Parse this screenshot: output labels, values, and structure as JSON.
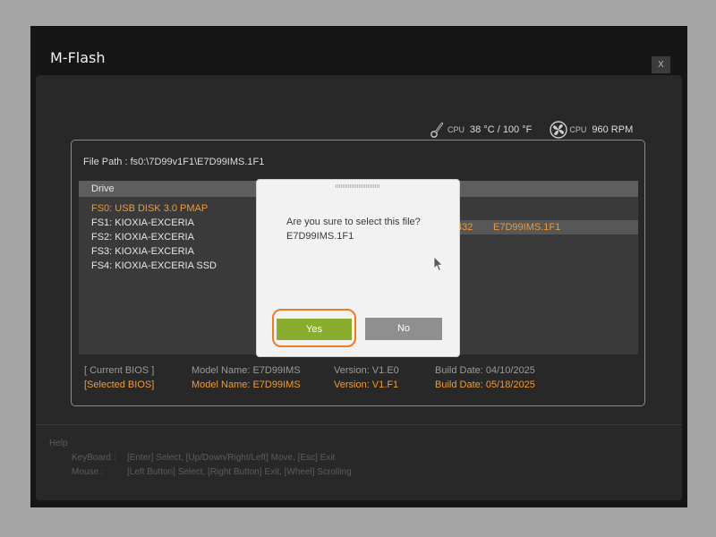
{
  "window": {
    "title": "M-Flash",
    "close_label": "X"
  },
  "status": {
    "temp_icon": "thermometer-icon",
    "temp_caption": "CPU",
    "temp_value": "38 °C / 100 °F",
    "fan_icon": "fan-icon",
    "fan_caption": "CPU",
    "fan_value": "960 RPM"
  },
  "file_path": "File Path : fs0:\\7D99v1F1\\E7D99IMS.1F1",
  "drive_header": "Drive",
  "drives": [
    {
      "name": "FS0:   USB DISK 3.0 PMAP",
      "selected": true
    },
    {
      "name": "FS1: KIOXIA-EXCERIA",
      "selected": false
    },
    {
      "name": "FS2: KIOXIA-EXCERIA",
      "selected": false
    },
    {
      "name": "FS3: KIOXIA-EXCERIA",
      "selected": false
    },
    {
      "name": "FS4: KIOXIA-EXCERIA SSD",
      "selected": false
    }
  ],
  "file_entry": {
    "size": "432",
    "name": "E7D99IMS.1F1"
  },
  "bios": {
    "current": {
      "label": "[ Current BIOS  ]",
      "model": "Model Name: E7D99IMS",
      "version": "Version: V1.E0",
      "date": "Build Date: 04/10/2025"
    },
    "selected": {
      "label": "[Selected BIOS]",
      "model": "Model Name: E7D99IMS",
      "version": "Version: V1.F1",
      "date": "Build Date: 05/18/2025"
    }
  },
  "help": {
    "title": "Help",
    "keyboard_label": "KeyBoard :",
    "keyboard_text": "[Enter]  Select,   [Up/Down/Right/Left]  Move,   [Esc]  Exit",
    "mouse_label": "Mouse     :",
    "mouse_text": "[Left Button]  Select,   [Right Button]  Exit,   [Wheel]  Scrolling"
  },
  "dialog": {
    "message": "Are you sure to select this file?",
    "filename": "E7D99IMS.1F1",
    "yes_label": "Yes",
    "no_label": "No"
  },
  "colors": {
    "accent": "#ef9a3a",
    "yes_button": "#8bad2e",
    "highlight_ring": "#f07c1e"
  }
}
